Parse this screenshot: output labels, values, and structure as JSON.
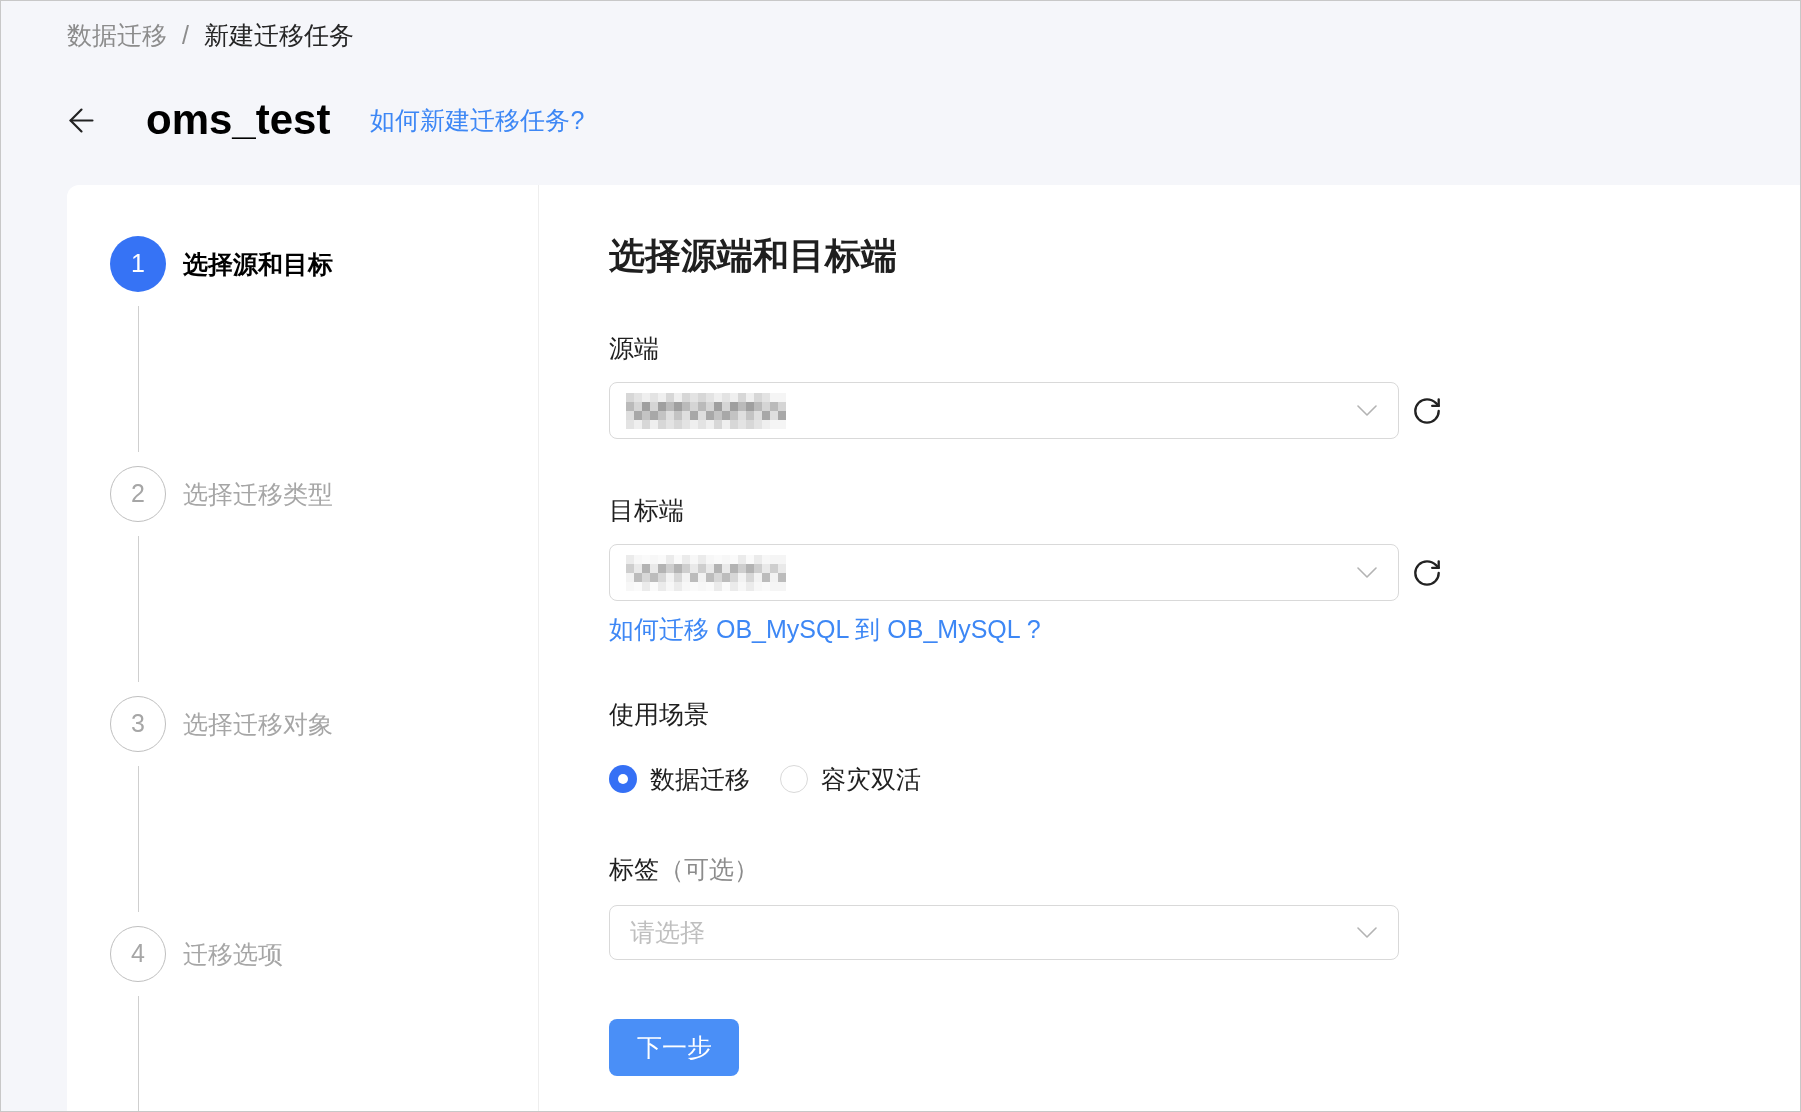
{
  "breadcrumb": [
    {
      "label": "数据迁移",
      "current": false
    },
    {
      "label": "新建迁移任务",
      "current": true
    }
  ],
  "breadcrumb_separator": "/",
  "header": {
    "title": "oms_test",
    "help_link": "如何新建迁移任务?"
  },
  "steps": [
    {
      "number": "1",
      "label": "选择源和目标",
      "selected": true
    },
    {
      "number": "2",
      "label": "选择迁移类型",
      "selected": false
    },
    {
      "number": "3",
      "label": "选择迁移对象",
      "selected": false
    },
    {
      "number": "4",
      "label": "迁移选项",
      "selected": false
    }
  ],
  "form": {
    "title": "选择源端和目标端",
    "source": {
      "label": "源端",
      "value_pixelated": true
    },
    "target": {
      "label": "目标端",
      "value_pixelated": true
    },
    "migration_help_link": "如何迁移 OB_MySQL 到 OB_MySQL ?",
    "scenario": {
      "label": "使用场景",
      "options": [
        {
          "label": "数据迁移",
          "selected": true
        },
        {
          "label": "容灾双活",
          "selected": false
        }
      ]
    },
    "tags": {
      "label": "标签",
      "optional_hint": "（可选）",
      "placeholder": "请选择"
    },
    "next_button": "下一步"
  }
}
